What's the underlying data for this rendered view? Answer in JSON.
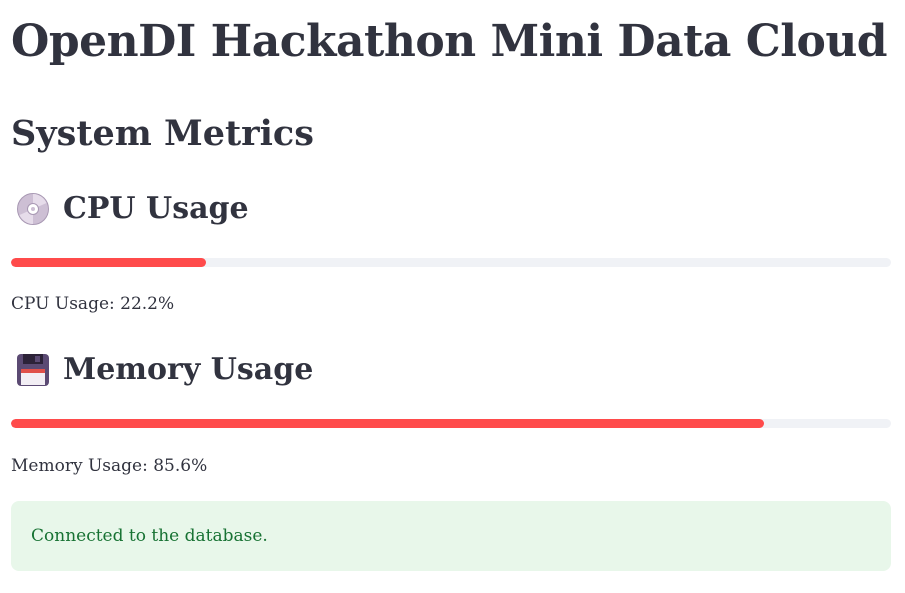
{
  "app": {
    "title": "OpenDI Hackathon Mini Data Cloud"
  },
  "section": {
    "title": "System Metrics"
  },
  "cpu": {
    "icon": "disc-icon",
    "label": "CPU Usage",
    "usage_percent": 22.2,
    "text": "CPU Usage: 22.2%"
  },
  "memory": {
    "icon": "floppy-disk-icon",
    "label": "Memory Usage",
    "usage_percent": 85.6,
    "text": "Memory Usage: 85.6%"
  },
  "status": {
    "message": "Connected to the database."
  },
  "colors": {
    "progress_fill": "#ff4b4b",
    "progress_track": "#f0f2f6",
    "success_bg": "#e8f7ea",
    "success_text": "#177233",
    "text": "#31333f"
  }
}
